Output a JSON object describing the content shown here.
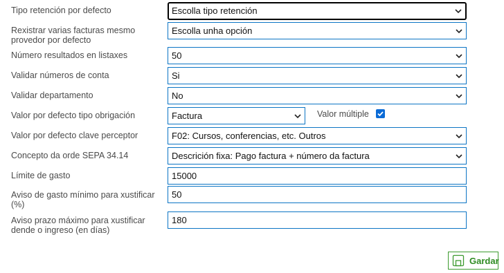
{
  "fields": [
    {
      "label": "Tipo retención por defecto",
      "value": "Escolla tipo retención",
      "type": "select"
    },
    {
      "label": "Rexistrar varias facturas mesmo provedor por defecto",
      "value": "Escolla unha opción",
      "type": "select"
    },
    {
      "label": "Número resultados en listaxes",
      "value": "50",
      "type": "select"
    },
    {
      "label": "Validar números de conta",
      "value": "Si",
      "type": "select"
    },
    {
      "label": "Validar departamento",
      "value": "No",
      "type": "select"
    },
    {
      "label": "Valor por defecto tipo obrigación",
      "value": "Factura",
      "type": "select"
    },
    {
      "label": "Valor por defecto clave perceptor",
      "value": "F02: Cursos, conferencias, etc. Outros",
      "type": "select"
    },
    {
      "label": "Concepto da orde SEPA 34.14",
      "value": "Descrición fixa: Pago factura + número da factura",
      "type": "select"
    },
    {
      "label": "Límite de gasto",
      "value": "15000",
      "type": "input"
    },
    {
      "label": "Aviso de gasto mínimo para xustificar (%)",
      "value": "50",
      "type": "input"
    },
    {
      "label": "Aviso prazo máximo para xustificar dende o ingreso (en días)",
      "value": "180",
      "type": "input"
    }
  ],
  "multiple": {
    "label": "Valor múltiple",
    "checked": true
  },
  "save_label": "Gardar",
  "colors": {
    "border": "#0b74c4",
    "save": "#2e8b22",
    "checkbox": "#0b6bd6"
  }
}
